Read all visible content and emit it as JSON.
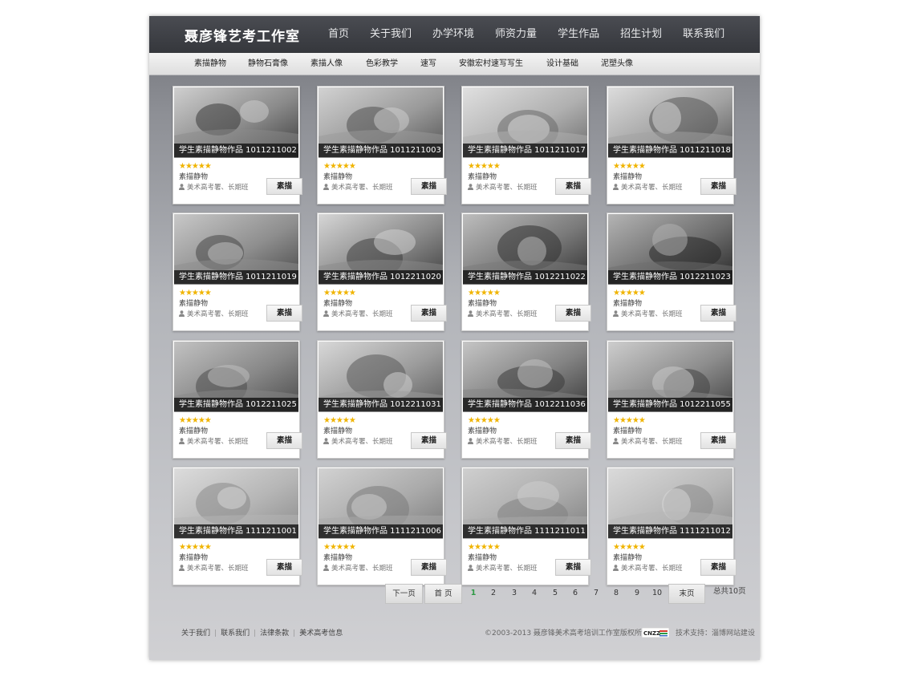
{
  "header": {
    "logo": "聂彦锋艺考工作室",
    "nav": [
      "首页",
      "关于我们",
      "办学环境",
      "师资力量",
      "学生作品",
      "招生计划",
      "联系我们"
    ]
  },
  "subnav": [
    "素描静物",
    "静物石膏像",
    "素描人像",
    "色彩教学",
    "速写",
    "安徽宏村速写写生",
    "设计基础",
    "泥塑头像"
  ],
  "works": [
    {
      "title": "学生素描静物作品 1011211002",
      "stars": "★★★★★",
      "category": "素描静物",
      "meta": "美术高考署、长期班",
      "tag": "素描"
    },
    {
      "title": "学生素描静物作品 1011211003",
      "stars": "★★★★★",
      "category": "素描静物",
      "meta": "美术高考署、长期班",
      "tag": "素描"
    },
    {
      "title": "学生素描静物作品 1011211017",
      "stars": "★★★★★",
      "category": "素描静物",
      "meta": "美术高考署、长期班",
      "tag": "素描"
    },
    {
      "title": "学生素描静物作品 1011211018",
      "stars": "★★★★★",
      "category": "素描静物",
      "meta": "美术高考署、长期班",
      "tag": "素描"
    },
    {
      "title": "学生素描静物作品 1011211019",
      "stars": "★★★★★",
      "category": "素描静物",
      "meta": "美术高考署、长期班",
      "tag": "素描"
    },
    {
      "title": "学生素描静物作品 1012211020",
      "stars": "★★★★★",
      "category": "素描静物",
      "meta": "美术高考署、长期班",
      "tag": "素描"
    },
    {
      "title": "学生素描静物作品 1012211022",
      "stars": "★★★★★",
      "category": "素描静物",
      "meta": "美术高考署、长期班",
      "tag": "素描"
    },
    {
      "title": "学生素描静物作品 1012211023",
      "stars": "★★★★★",
      "category": "素描静物",
      "meta": "美术高考署、长期班",
      "tag": "素描"
    },
    {
      "title": "学生素描静物作品 1012211025",
      "stars": "★★★★★",
      "category": "素描静物",
      "meta": "美术高考署、长期班",
      "tag": "素描"
    },
    {
      "title": "学生素描静物作品 1012211031",
      "stars": "★★★★★",
      "category": "素描静物",
      "meta": "美术高考署、长期班",
      "tag": "素描"
    },
    {
      "title": "学生素描静物作品 1012211036",
      "stars": "★★★★★",
      "category": "素描静物",
      "meta": "美术高考署、长期班",
      "tag": "素描"
    },
    {
      "title": "学生素描静物作品 1012211055",
      "stars": "★★★★★",
      "category": "素描静物",
      "meta": "美术高考署、长期班",
      "tag": "素描"
    },
    {
      "title": "学生素描静物作品 1111211001",
      "stars": "★★★★★",
      "category": "素描静物",
      "meta": "美术高考署、长期班",
      "tag": "素描"
    },
    {
      "title": "学生素描静物作品 1111211006",
      "stars": "★★★★★",
      "category": "素描静物",
      "meta": "美术高考署、长期班",
      "tag": "素描"
    },
    {
      "title": "学生素描静物作品 1111211011",
      "stars": "★★★★★",
      "category": "素描静物",
      "meta": "美术高考署、长期班",
      "tag": "素描"
    },
    {
      "title": "学生素描静物作品 1111211012",
      "stars": "★★★★★",
      "category": "素描静物",
      "meta": "美术高考署、长期班",
      "tag": "素描"
    }
  ],
  "pagination": {
    "next": "下一页",
    "first": "首 页",
    "pages": [
      "1",
      "2",
      "3",
      "4",
      "5",
      "6",
      "7",
      "8",
      "9",
      "10"
    ],
    "current": "1",
    "last": "末页",
    "total": "总共10页"
  },
  "footer": {
    "links": [
      "关于我们",
      "联系我们",
      "法律条款",
      "美术高考信息"
    ],
    "copyright": "©2003-2013 聂彦锋美术高考培训工作室版权所有",
    "badge": "CNZZ",
    "support": "技术支持：淄博网站建设"
  },
  "colors": {
    "header_bg": "#3c3e43",
    "star": "#f0b400",
    "active_page": "#2e9a45"
  }
}
